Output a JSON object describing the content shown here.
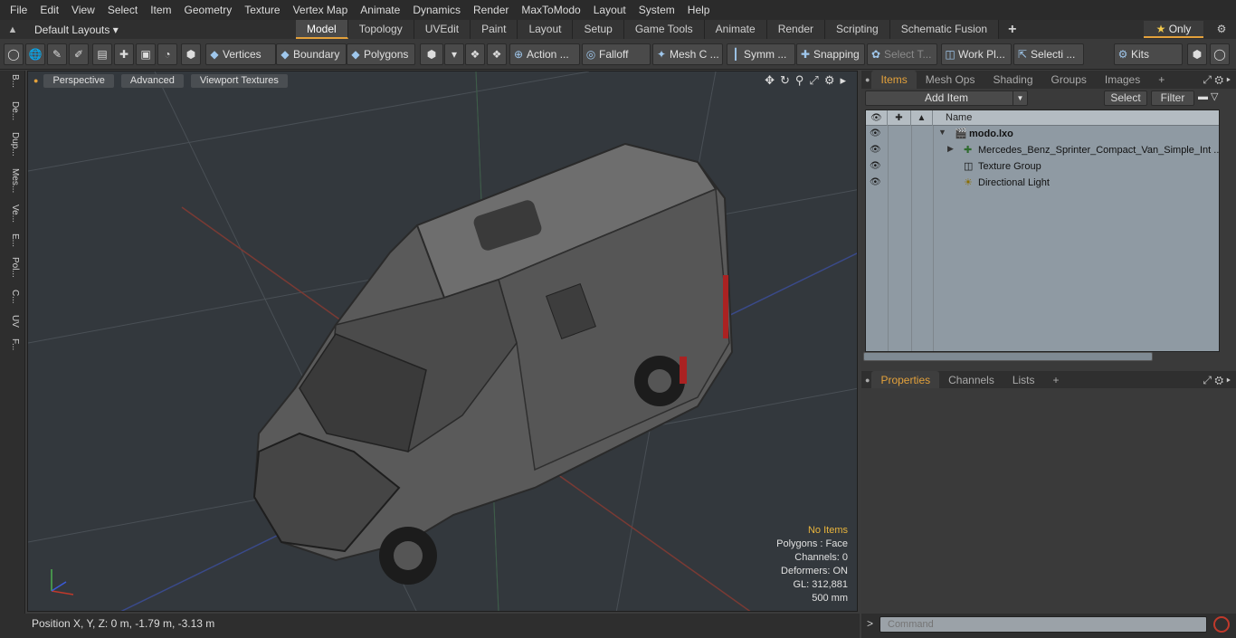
{
  "menu": [
    "File",
    "Edit",
    "View",
    "Select",
    "Item",
    "Geometry",
    "Texture",
    "Vertex Map",
    "Animate",
    "Dynamics",
    "Render",
    "MaxToModo",
    "Layout",
    "System",
    "Help"
  ],
  "layout": {
    "dropdown": "Default Layouts ▾",
    "tabs": [
      "Model",
      "Topology",
      "UVEdit",
      "Paint",
      "Layout",
      "Setup",
      "Game Tools",
      "Animate",
      "Render",
      "Scripting",
      "Schematic Fusion"
    ],
    "active_tab": "Model",
    "plus": "+",
    "only": "Only"
  },
  "toolbar": {
    "vertices": "Vertices",
    "boundary": "Boundary",
    "polygons": "Polygons",
    "action": "Action",
    "action_more": "...",
    "falloff": "Falloff",
    "mesh": "Mesh C ...",
    "symm": "Symm ...",
    "snapping": "Snapping",
    "select_t": "Select T...",
    "work_pl": "Work Pl...",
    "selecti": "Selecti ...",
    "kits": "Kits"
  },
  "left_tabs": [
    "B...",
    "De...",
    "Dup...",
    "Mes...",
    "Ve...",
    "E...",
    "Pol...",
    "C...",
    "UV",
    "F..."
  ],
  "viewport": {
    "perspective": "Perspective",
    "advanced": "Advanced",
    "textures": "Viewport Textures",
    "info": {
      "no_items": "No Items",
      "polygons": "Polygons : Face",
      "channels": "Channels: 0",
      "deformers": "Deformers: ON",
      "gl": "GL: 312,881",
      "scale": "500 mm"
    }
  },
  "status": {
    "position": "Position X, Y, Z:   0 m, -1.79 m, -3.13 m"
  },
  "items_panel": {
    "tabs": [
      "Items",
      "Mesh Ops",
      "Shading",
      "Groups",
      "Images"
    ],
    "active_tab": "Items",
    "plus": "+",
    "add_item": "Add Item",
    "select": "Select",
    "filter": "Filter",
    "col_name": "Name",
    "rows": [
      {
        "label": "modo.lxo"
      },
      {
        "label": "Mercedes_Benz_Sprinter_Compact_Van_Simple_Int ..."
      },
      {
        "label": "Texture Group"
      },
      {
        "label": "Directional Light"
      }
    ]
  },
  "properties_panel": {
    "tabs": [
      "Properties",
      "Channels",
      "Lists"
    ],
    "active_tab": "Properties",
    "plus": "+"
  },
  "command": {
    "placeholder": "Command",
    "prompt": ">"
  },
  "colors": {
    "accent": "#e3a13b",
    "viewport_bg": "#33383d",
    "list_bg": "#8f9aa3"
  }
}
